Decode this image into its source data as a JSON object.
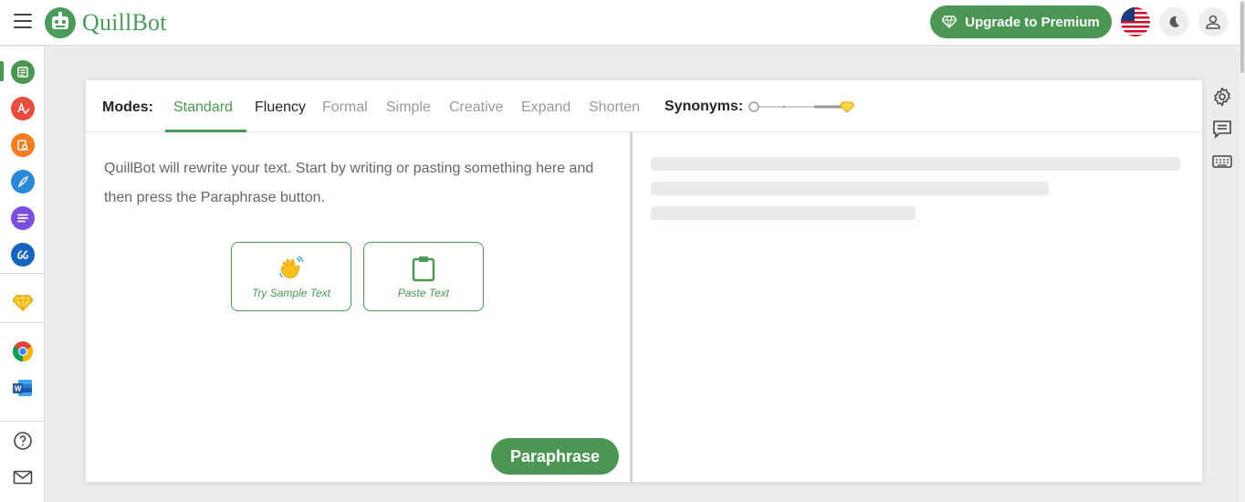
{
  "header": {
    "logo_text": "QuillBot",
    "upgrade_label": "Upgrade to Premium",
    "icons": [
      "menu-icon",
      "diamond-icon",
      "us-flag-icon",
      "moon-icon",
      "user-icon"
    ]
  },
  "sidebar": {
    "items": [
      {
        "name": "paraphraser",
        "icon": "paraphraser-icon",
        "color": "#4a9652",
        "active": true
      },
      {
        "name": "grammar-checker",
        "icon": "grammar-icon",
        "color": "#e74c3c"
      },
      {
        "name": "plagiarism-checker",
        "icon": "plagiarism-icon",
        "color": "#f57c1f"
      },
      {
        "name": "co-writer",
        "icon": "cowriter-icon",
        "color": "#2e88d9"
      },
      {
        "name": "summarizer",
        "icon": "summarizer-icon",
        "color": "#7a4fde"
      },
      {
        "name": "citation-generator",
        "icon": "citation-icon",
        "color": "#1565c0"
      },
      {
        "name": "premium",
        "icon": "diamond-icon",
        "color": "#e0a800"
      },
      {
        "name": "chrome-extension",
        "icon": "chrome-icon"
      },
      {
        "name": "word-addin",
        "icon": "word-icon",
        "color": "#2b579a"
      },
      {
        "name": "help",
        "icon": "help-icon"
      },
      {
        "name": "contact",
        "icon": "mail-icon"
      }
    ]
  },
  "modes": {
    "label": "Modes:",
    "items": [
      "Standard",
      "Fluency",
      "Formal",
      "Simple",
      "Creative",
      "Expand",
      "Shorten"
    ],
    "active": "Standard",
    "synonyms_label": "Synonyms:"
  },
  "input": {
    "placeholder": "QuillBot will rewrite your text. Start by writing or pasting something here and then press the Paraphrase button.",
    "sample_label": "Try Sample Text",
    "paste_label": "Paste Text",
    "paraphrase_label": "Paraphrase"
  },
  "tools": [
    "settings-icon",
    "comment-icon",
    "keyboard-icon"
  ],
  "colors": {
    "accent": "#4a9652",
    "premium": "#e0a800"
  }
}
